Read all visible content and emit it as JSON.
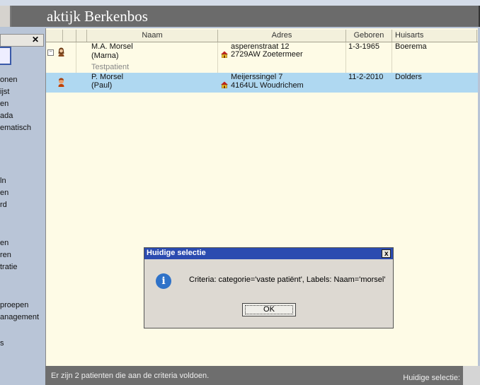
{
  "window": {
    "title": "aktijk Berkenbos"
  },
  "left_panel": {
    "items": [
      "onen",
      "ijst",
      "en",
      "ada",
      "ematisch",
      "ln",
      "en",
      "rd",
      "en",
      "ren",
      "tratie",
      "proepen",
      "anagement",
      "s"
    ]
  },
  "table": {
    "columns": [
      "",
      "",
      "Naam",
      "Adres",
      "Geboren",
      "Huisarts"
    ],
    "rows": [
      {
        "name_line1": "M.A. Morsel",
        "name_line2": "(Marna)",
        "name_line3": "Testpatient",
        "address_line1": "asperenstraat 12",
        "address_line2": "2729AW Zoetermeer",
        "born": "1-3-1965",
        "gp": "Boerema"
      },
      {
        "name_line1": "P. Morsel",
        "name_line2": "(Paul)",
        "address_line1": "Meijerssingel 7",
        "address_line2": "4164UL Woudrichem",
        "born": "11-2-2010",
        "gp": "Dolders"
      }
    ]
  },
  "status": {
    "message": "Er zijn 2 patienten die aan de criteria voldoen.",
    "selection_label": "Huidige selectie:"
  },
  "dialog": {
    "title": "Huidige selectie",
    "message": "Criteria: categorie='vaste patiënt', Labels: Naam='morsel'",
    "ok_label": "OK",
    "close_label": "x"
  },
  "colors": {
    "selected_row": "#afd8f1",
    "dialog_title": "#2b4bb0",
    "table_bg": "#fefbe6"
  }
}
